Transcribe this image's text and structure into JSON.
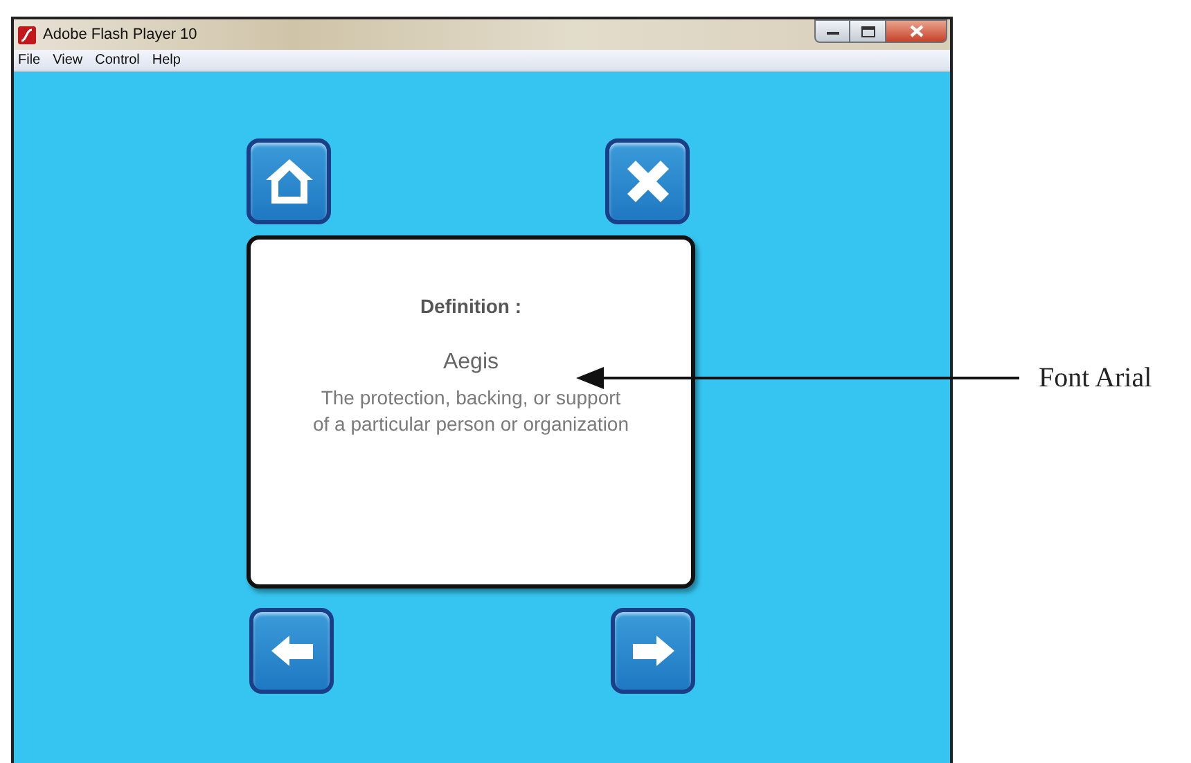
{
  "window": {
    "title": "Adobe Flash Player 10"
  },
  "menu": [
    "File",
    "View",
    "Control",
    "Help"
  ],
  "top_buttons": [
    {
      "kind": "home"
    },
    {
      "kind": "close"
    }
  ],
  "card": {
    "heading": "Definition :",
    "term": "Aegis",
    "definition_lines": [
      "The protection, backing, or support",
      "of a particular person or organization"
    ]
  },
  "bottom_buttons": [
    {
      "kind": "back"
    },
    {
      "kind": "forward"
    }
  ],
  "annotation": {
    "label": "Font Arial"
  }
}
